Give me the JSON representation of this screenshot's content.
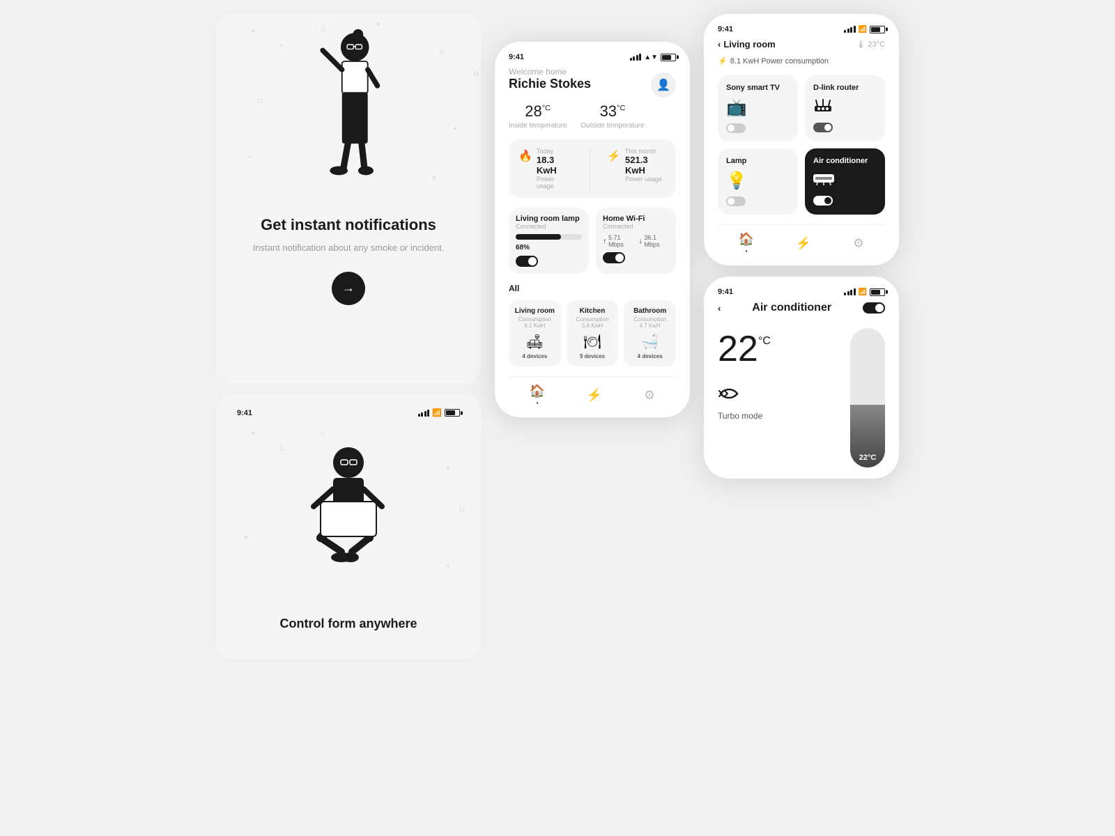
{
  "notifications_card": {
    "title": "Get instant notifications",
    "description": "Instant notification about any smoke or incident.",
    "arrow_label": "→"
  },
  "control_card": {
    "title": "Control form anywhere",
    "status_time": "9:41"
  },
  "main_phone": {
    "status_time": "9:41",
    "welcome_text": "Welcome home",
    "user_name": "Richie Stokes",
    "inside_temp": "28",
    "inside_temp_unit": "°C",
    "inside_temp_label": "Inside temperature",
    "outside_temp": "33",
    "outside_temp_unit": "°C",
    "outside_temp_label": "Outside temperature",
    "today_label": "Today",
    "today_power": "18.3 KwH",
    "today_power_sub": "Power usage",
    "month_label": "This month",
    "month_power": "521.3 KwH",
    "month_power_sub": "Power usage",
    "lamp_name": "Living room lamp",
    "lamp_status": "Connected",
    "lamp_progress": "68%",
    "lamp_progress_pct": 68,
    "wifi_name": "Home Wi-Fi",
    "wifi_status": "Connected",
    "wifi_up": "5.71 Mbps",
    "wifi_down": "36.1 Mbps",
    "section_all": "All",
    "rooms": [
      {
        "name": "Living room",
        "consumption": "Consumption 8.1 KwH",
        "icon": "🛋",
        "devices": "4 devices"
      },
      {
        "name": "Kitchen",
        "consumption": "Consumption 5.8 KwH",
        "icon": "🍽",
        "devices": "5 devices"
      },
      {
        "name": "Bathroom",
        "consumption": "Consumption 4.7 KwH",
        "icon": "🛁",
        "devices": "4 devices"
      }
    ]
  },
  "living_room": {
    "status_time": "9:41",
    "back_label": "Living room",
    "temp_badge": "23°C",
    "power_consumption": "8.1 KwH Power consumption",
    "devices": [
      {
        "name": "Sony smart TV",
        "icon": "📺",
        "toggle": "off"
      },
      {
        "name": "D-link router",
        "icon": "📡",
        "toggle": "on"
      },
      {
        "name": "Lamp",
        "icon": "💡",
        "toggle": "off"
      },
      {
        "name": "Air conditioner",
        "icon": "❄",
        "toggle": "on",
        "dark": true
      }
    ]
  },
  "ac_screen": {
    "status_time": "9:41",
    "back_label": "Air conditioner",
    "temp": "22",
    "temp_unit": "°C",
    "mode_icon": "💨",
    "mode_label": "Turbo mode",
    "slider_value": "22°C",
    "slider_fill_pct": 45,
    "toggle_state": "on"
  }
}
